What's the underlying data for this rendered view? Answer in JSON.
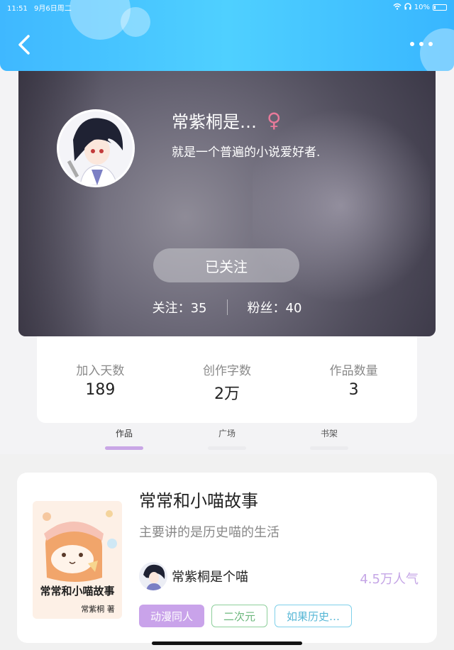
{
  "status_bar": {
    "time": "11:51",
    "date": "9月6日周二",
    "battery": "10%"
  },
  "profile": {
    "name": "常紫桐是…",
    "gender_symbol": "♀",
    "bio": "就是一个普遍的小说爱好者.",
    "follow_button": "已关注",
    "following_label": "关注：",
    "following_count": "35",
    "fans_label": "粉丝：",
    "fans_count": "40"
  },
  "stats": [
    {
      "label": "加入天数",
      "value": "189"
    },
    {
      "label": "创作字数",
      "value": "2万"
    },
    {
      "label": "作品数量",
      "value": "3"
    }
  ],
  "tabs": [
    {
      "label": "作品",
      "active": true
    },
    {
      "label": "广场",
      "active": false
    },
    {
      "label": "书架",
      "active": false
    }
  ],
  "book": {
    "title": "常常和小喵故事",
    "description": "主要讲的是历史喵的生活",
    "author": "常紫桐是个喵",
    "popularity": "4.5万人气",
    "cover_text": "常常和小喵故事",
    "cover_signature": "常紫桐 著",
    "tags": [
      "动漫同人",
      "二次元",
      "如果历史…"
    ]
  },
  "colors": {
    "header": "#3fb8ff",
    "accent_purple": "#c9a3ea",
    "tag_green": "#8ecf9b",
    "tag_blue": "#7fd0ea",
    "female_pink": "#e87a9a"
  }
}
